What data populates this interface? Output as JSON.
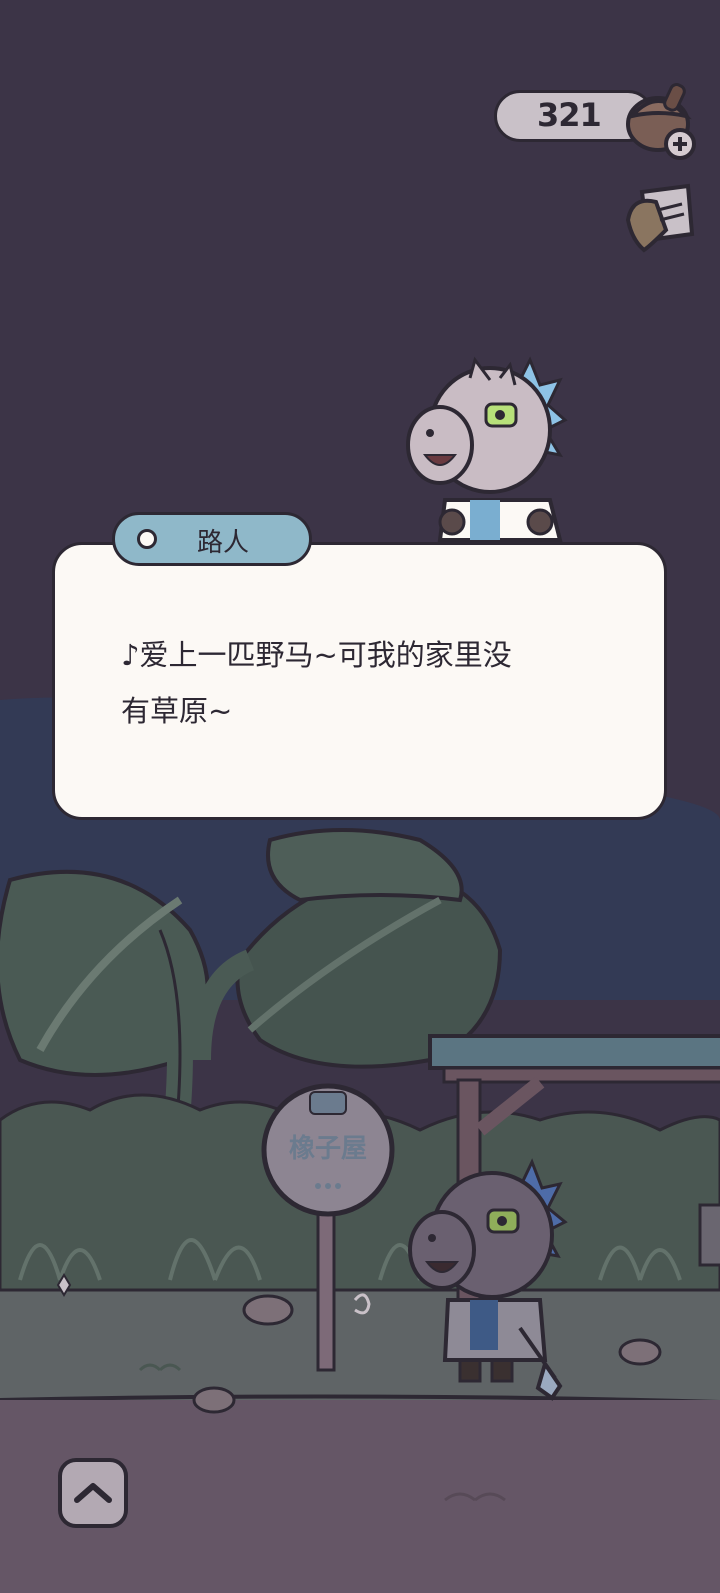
{
  "hud": {
    "currency_value": "321",
    "currency_icon": "acorn-plus-icon",
    "note_icon": "letter-icon"
  },
  "dialog": {
    "speaker": "路人",
    "text": "♪爱上一匹野马~可我的家里没\n有草原~"
  },
  "scene": {
    "bus_stop_sign": "橡子屋"
  },
  "controls": {
    "expand_icon": "chevron-up-icon"
  },
  "colors": {
    "night_sky": "#3c3447",
    "dialog_bg": "#fcf9f5",
    "speaker_tag": "#8fb8c9",
    "outline": "#2d2833"
  }
}
